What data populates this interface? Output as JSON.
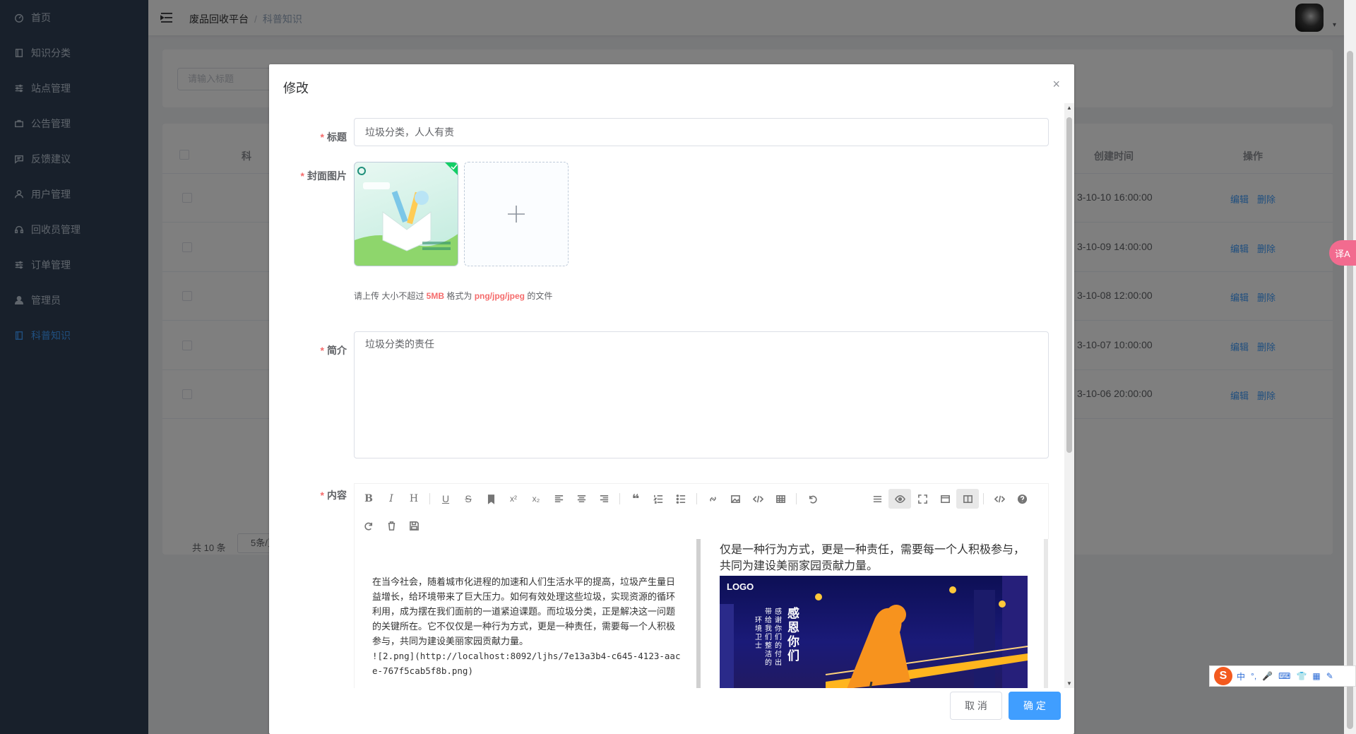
{
  "sidebar": {
    "items": [
      {
        "label": "首页",
        "icon": "dashboard-icon",
        "active": false
      },
      {
        "label": "知识分类",
        "icon": "book-icon",
        "active": false
      },
      {
        "label": "站点管理",
        "icon": "sliders-icon",
        "active": false
      },
      {
        "label": "公告管理",
        "icon": "briefcase-icon",
        "active": false
      },
      {
        "label": "反馈建议",
        "icon": "message-icon",
        "active": false
      },
      {
        "label": "用户管理",
        "icon": "user-icon",
        "active": false
      },
      {
        "label": "回收员管理",
        "icon": "headset-icon",
        "active": false
      },
      {
        "label": "订单管理",
        "icon": "sliders-icon",
        "active": false
      },
      {
        "label": "管理员",
        "icon": "user-solid-icon",
        "active": false
      },
      {
        "label": "科普知识",
        "icon": "book-icon",
        "active": true
      }
    ]
  },
  "navbar": {
    "breadcrumb_home": "废品回收平台",
    "breadcrumb_sep": "/",
    "breadcrumb_current": "科普知识",
    "avatar_caret": "▾"
  },
  "search": {
    "placeholder": "请输入标题"
  },
  "table": {
    "headers": {
      "col2_partial": "科",
      "created": "创建时间",
      "actions": "操作"
    },
    "rows": [
      {
        "created": "3-10-10 16:00:00",
        "edit": "编辑",
        "delete": "删除"
      },
      {
        "created": "3-10-09 14:00:00",
        "edit": "编辑",
        "delete": "删除"
      },
      {
        "created": "3-10-08 12:00:00",
        "edit": "编辑",
        "delete": "删除"
      },
      {
        "created": "3-10-07 10:00:00",
        "edit": "编辑",
        "delete": "删除"
      },
      {
        "created": "3-10-06 20:00:00",
        "edit": "编辑",
        "delete": "删除"
      }
    ],
    "total_text": "共 10 条",
    "page_size": "5条/页"
  },
  "dialog": {
    "title": "修改",
    "close": "×",
    "fields": {
      "title_label": "标题",
      "title_value": "垃圾分类，人人有责",
      "cover_label": "封面图片",
      "upload_tip_prefix": "请上传 大小不超过 ",
      "upload_tip_size": "5MB",
      "upload_tip_mid": " 格式为 ",
      "upload_tip_format": "png/jpg/jpeg",
      "upload_tip_suffix": " 的文件",
      "intro_label": "简介",
      "intro_value": "垃圾分类的责任",
      "content_label": "内容"
    },
    "editor": {
      "source_text": "在当今社会，随着城市化进程的加速和人们生活水平的提高，垃圾产生量日益增长，给环境带来了巨大压力。如何有效处理这些垃圾，实现资源的循环利用，成为摆在我们面前的一道紧迫课题。而垃圾分类，正是解决这一问题的关键所在。它不仅仅是一种行为方式，更是一种责任，需要每一个人积极参与，共同为建设美丽家园贡献力量。",
      "source_markdown": "![2.png](http://localhost:8092/ljhs/7e13a3b4-c645-4123-aace-767f5cab5f8b.png)",
      "preview_text": "仅是一种行为方式，更是一种责任，需要每一个人积极参与，共同为建设美丽家园贡献力量。",
      "preview_logo": "LOGO",
      "preview_poster_title": "感恩你们",
      "preview_poster_sub1": "感谢你们的付出",
      "preview_poster_sub2": "带给我们整洁的",
      "preview_poster_sub3": "环境卫士"
    },
    "cancel_label": "取 消",
    "ok_label": "确 定"
  },
  "overlay_widgets": {
    "translate_badge": "译A",
    "ime_logo": "S",
    "ime_mode": "中",
    "ime_punct": "°,"
  },
  "colors": {
    "primary": "#409eff",
    "sidebar_bg": "#304156",
    "danger": "#f56c6c"
  }
}
